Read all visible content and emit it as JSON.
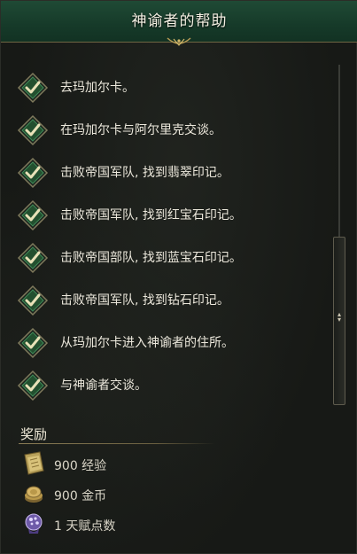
{
  "header": {
    "title": "神谕者的帮助"
  },
  "tasks": [
    {
      "label": "去玛加尔卡。",
      "completed": true
    },
    {
      "label": "在玛加尔卡与阿尔里克交谈。",
      "completed": true
    },
    {
      "label": "击败帝国军队, 找到翡翠印记。",
      "completed": true
    },
    {
      "label": "击败帝国军队, 找到红宝石印记。",
      "completed": true
    },
    {
      "label": "击败帝国部队, 找到蓝宝石印记。",
      "completed": true
    },
    {
      "label": "击败帝国军队, 找到钻石印记。",
      "completed": true
    },
    {
      "label": "从玛加尔卡进入神谕者的住所。",
      "completed": true
    },
    {
      "label": "与神谕者交谈。",
      "completed": true
    }
  ],
  "rewards": {
    "title": "奖励",
    "items": [
      {
        "icon": "experience-tome-icon",
        "text": "900 经验"
      },
      {
        "icon": "gold-coins-icon",
        "text": "900 金币"
      },
      {
        "icon": "skill-point-icon",
        "text": "1 天赋点数"
      }
    ]
  },
  "colors": {
    "header_green": "#1f4a35",
    "check_green": "#2f7a4e",
    "gold_accent": "#8a7c55"
  }
}
